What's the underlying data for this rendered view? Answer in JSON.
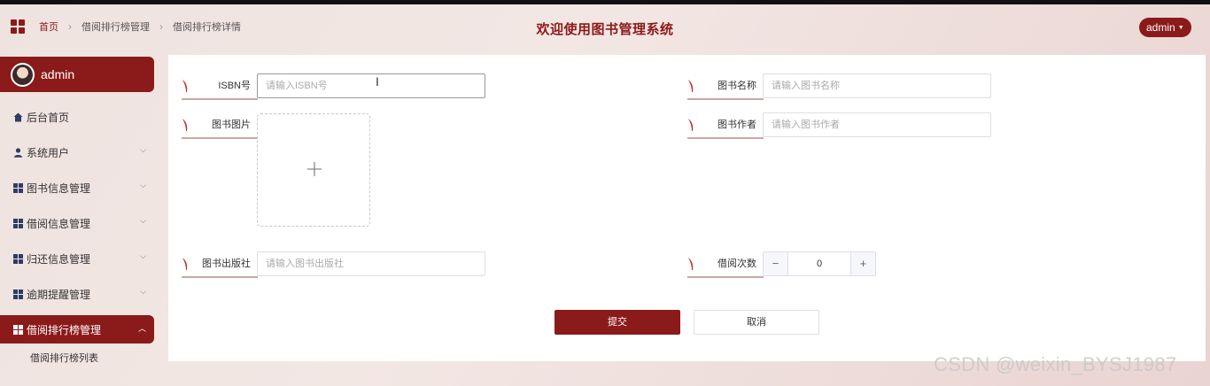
{
  "breadcrumb": {
    "home": "首页",
    "section": "借阅排行榜管理",
    "page": "借阅排行榜详情"
  },
  "header": {
    "title": "欢迎使用图书管理系统",
    "user": "admin"
  },
  "sidebar": {
    "profile_name": "admin",
    "items": [
      {
        "label": "后台首页",
        "icon": "home-icon"
      },
      {
        "label": "系统用户",
        "icon": "user-icon"
      },
      {
        "label": "图书信息管理",
        "icon": "dashboard-icon"
      },
      {
        "label": "借阅信息管理",
        "icon": "dashboard-icon"
      },
      {
        "label": "归还信息管理",
        "icon": "dashboard-icon"
      },
      {
        "label": "逾期提醒管理",
        "icon": "dashboard-icon"
      },
      {
        "label": "借阅排行榜管理",
        "icon": "dashboard-icon",
        "active": true
      }
    ],
    "sub_items": [
      {
        "label": "借阅排行榜列表"
      }
    ]
  },
  "form": {
    "isbn": {
      "label": "ISBN号",
      "placeholder": "请输入ISBN号"
    },
    "name": {
      "label": "图书名称",
      "placeholder": "请输入图书名称"
    },
    "image": {
      "label": "图书图片"
    },
    "author": {
      "label": "图书作者",
      "placeholder": "请输入图书作者"
    },
    "publisher": {
      "label": "图书出版社",
      "placeholder": "请输入图书出版社"
    },
    "borrow_count": {
      "label": "借阅次数",
      "value": "0"
    },
    "submit_label": "提交",
    "cancel_label": "取消"
  },
  "watermark": "CSDN @weixin_BYSJ1987",
  "colors": {
    "accent": "#8b1a1a"
  }
}
